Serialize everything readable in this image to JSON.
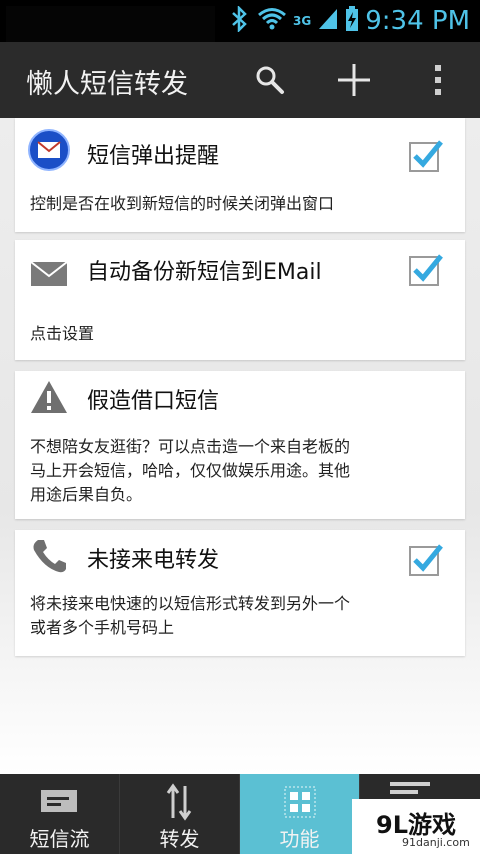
{
  "status_bar": {
    "time": "9:34 PM",
    "network": "3G",
    "icons": [
      "bluetooth-icon",
      "wifi-icon",
      "signal-icon",
      "battery-charging-icon"
    ]
  },
  "action_bar": {
    "title": "懒人短信转发",
    "actions": [
      "search-icon",
      "add-icon",
      "overflow-menu-icon"
    ]
  },
  "settings": [
    {
      "id": "sms-popup",
      "title": "短信弹出提醒",
      "desc": "控制是否在收到新短信的时候关闭弹出窗口",
      "checked": true,
      "icon": "email-circle-icon"
    },
    {
      "id": "email-backup",
      "title": "自动备份新短信到EMail",
      "desc": "点击设置",
      "checked": true,
      "icon": "envelope-icon"
    },
    {
      "id": "fake-excuse",
      "title": "假造借口短信",
      "desc_lines": [
        "不想陪女友逛街？可以点击造一个来自老板的",
        "马上开会短信，哈哈，仅仅做娱乐用途。其他",
        "用途后果自负。"
      ],
      "checked": null,
      "icon": "warning-icon"
    },
    {
      "id": "missed-call",
      "title": "未接来电转发",
      "desc_lines": [
        "将未接来电快速的以短信形式转发到另外一个",
        "或者多个手机号码上"
      ],
      "checked": true,
      "icon": "phone-icon"
    }
  ],
  "tabs": [
    {
      "label": "短信流",
      "icon": "sms-stream-icon",
      "active": false
    },
    {
      "label": "转发",
      "icon": "transfer-arrows-icon",
      "active": false
    },
    {
      "label": "功能",
      "icon": "grid-icon",
      "active": true
    },
    {
      "label": "",
      "icon": "list-icon",
      "active": false
    }
  ],
  "watermark": {
    "logo": "9L游戏",
    "url": "91danji.com"
  },
  "colors": {
    "accent": "#5bc0d3",
    "status_time": "#4fc3e8",
    "checkmark": "#35a9e0",
    "actionbar": "#2b2b2b"
  }
}
